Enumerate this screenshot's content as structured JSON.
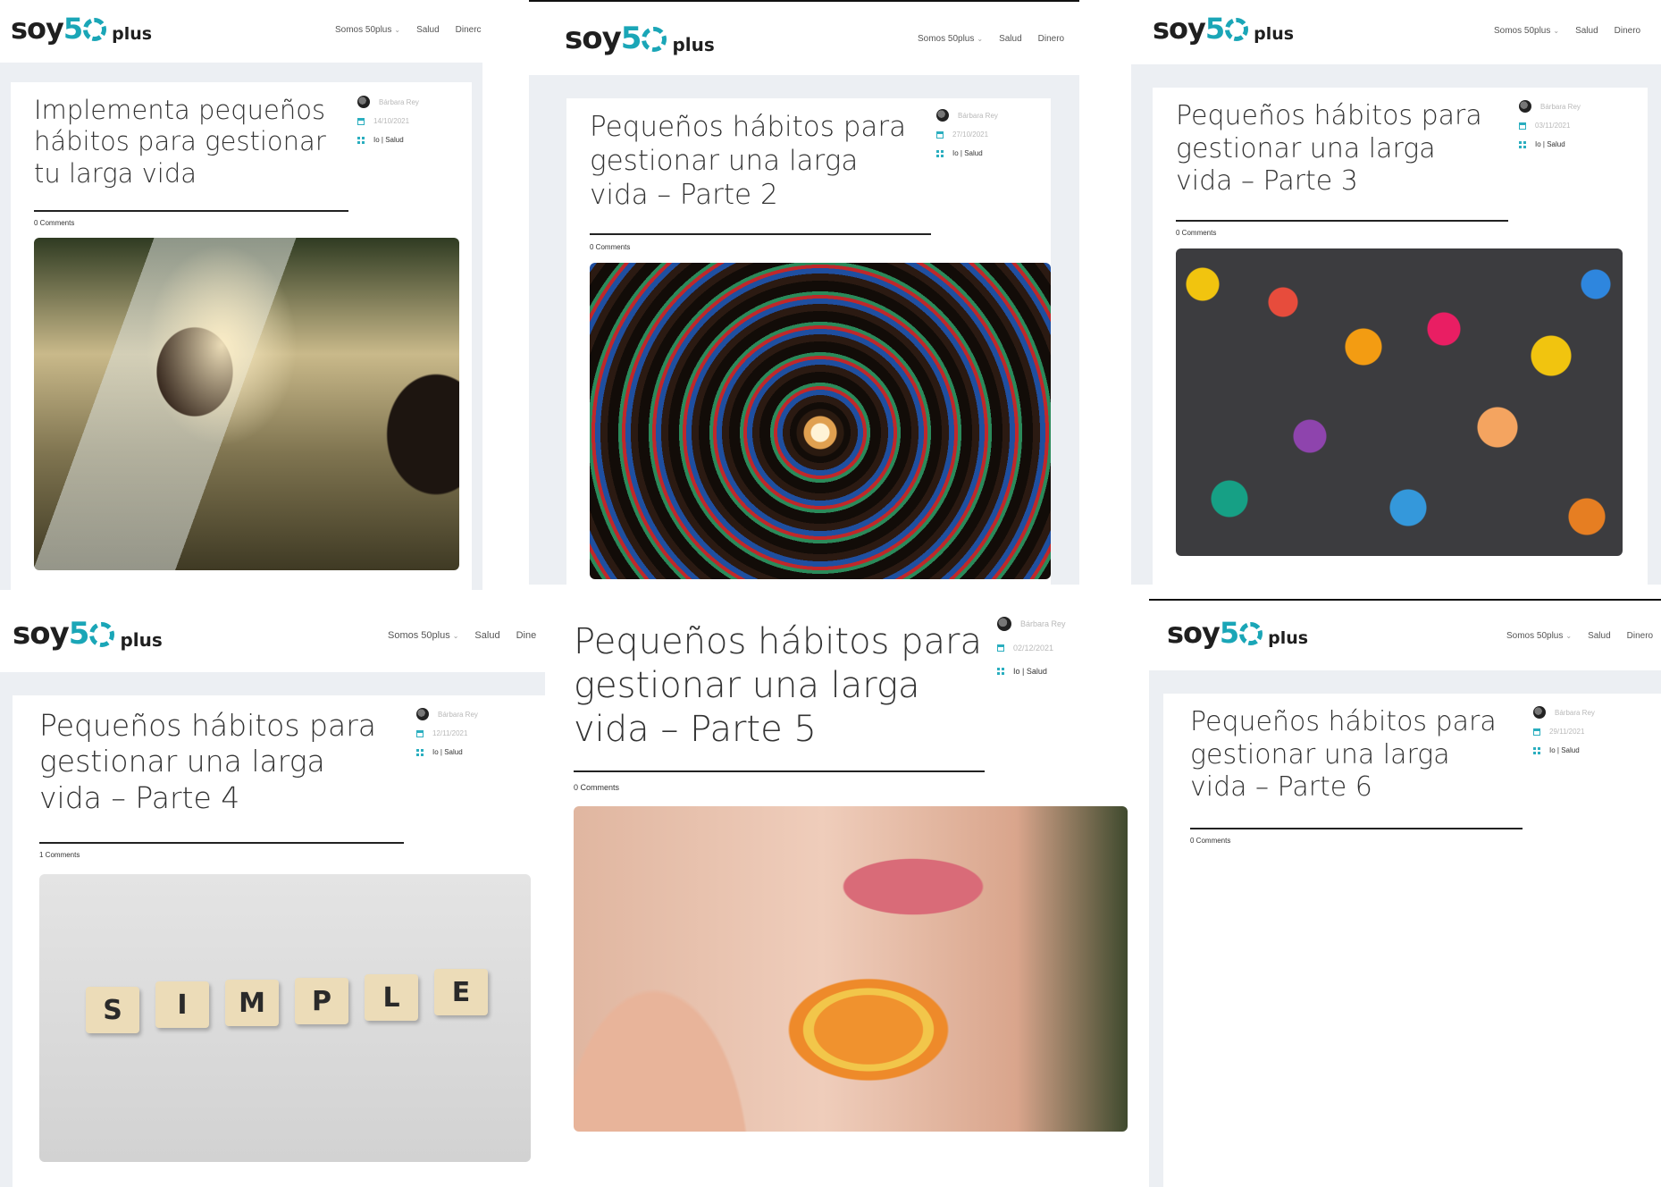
{
  "site": {
    "logo_soy": "soy",
    "logo_five": "5",
    "logo_plus": "plus",
    "nav": [
      "Somos 50plus",
      "Salud",
      "Dinero"
    ],
    "nav_clipped_1": "Dinerc",
    "nav_clipped_4": "Dine"
  },
  "posts": [
    {
      "title_lines": [
        "Implementa pequeños",
        "hábitos para gestionar",
        "tu larga vida"
      ],
      "author": "Bárbara Rey",
      "date": "14/10/2021",
      "categories": "Io | Salud",
      "comments": "0 Comments",
      "image": "woman-mirror-photo"
    },
    {
      "title_lines": [
        "Pequeños hábitos para",
        "gestionar una larga",
        "vida – Parte 2"
      ],
      "author": "Bárbara Rey",
      "date": "27/10/2021",
      "categories": "Io | Salud",
      "comments": "0 Comments",
      "image": "stained-glass-spiral-photo"
    },
    {
      "title_lines": [
        "Pequeños hábitos para",
        "gestionar una larga",
        "vida – Parte 3"
      ],
      "author": "Bárbara Rey",
      "date": "03/11/2021",
      "categories": "Io | Salud",
      "comments": "0 Comments",
      "image": "fridge-magnets-photo"
    },
    {
      "title_lines": [
        "Pequeños hábitos para",
        "gestionar una larga",
        "vida – Parte 4"
      ],
      "author": "Bárbara Rey",
      "date": "12/11/2021",
      "categories": "Io | Salud",
      "comments": "1 Comments",
      "image": "scrabble-simple-photo",
      "tiles": [
        "S",
        "I",
        "M",
        "P",
        "L",
        "E"
      ]
    },
    {
      "title_lines": [
        "Pequeños hábitos para",
        "gestionar una larga",
        "vida – Parte 5"
      ],
      "author": "Bárbara Rey",
      "date": "02/12/2021",
      "categories": "Io | Salud",
      "comments": "0 Comments",
      "image": "macaron-lips-photo"
    },
    {
      "title_lines": [
        "Pequeños hábitos para",
        "gestionar una larga",
        "vida – Parte 6"
      ],
      "author": "Bárbara Rey",
      "date": "29/11/2021",
      "categories": "Io | Salud",
      "comments": "0 Comments",
      "image": "runner-road-photo"
    }
  ]
}
